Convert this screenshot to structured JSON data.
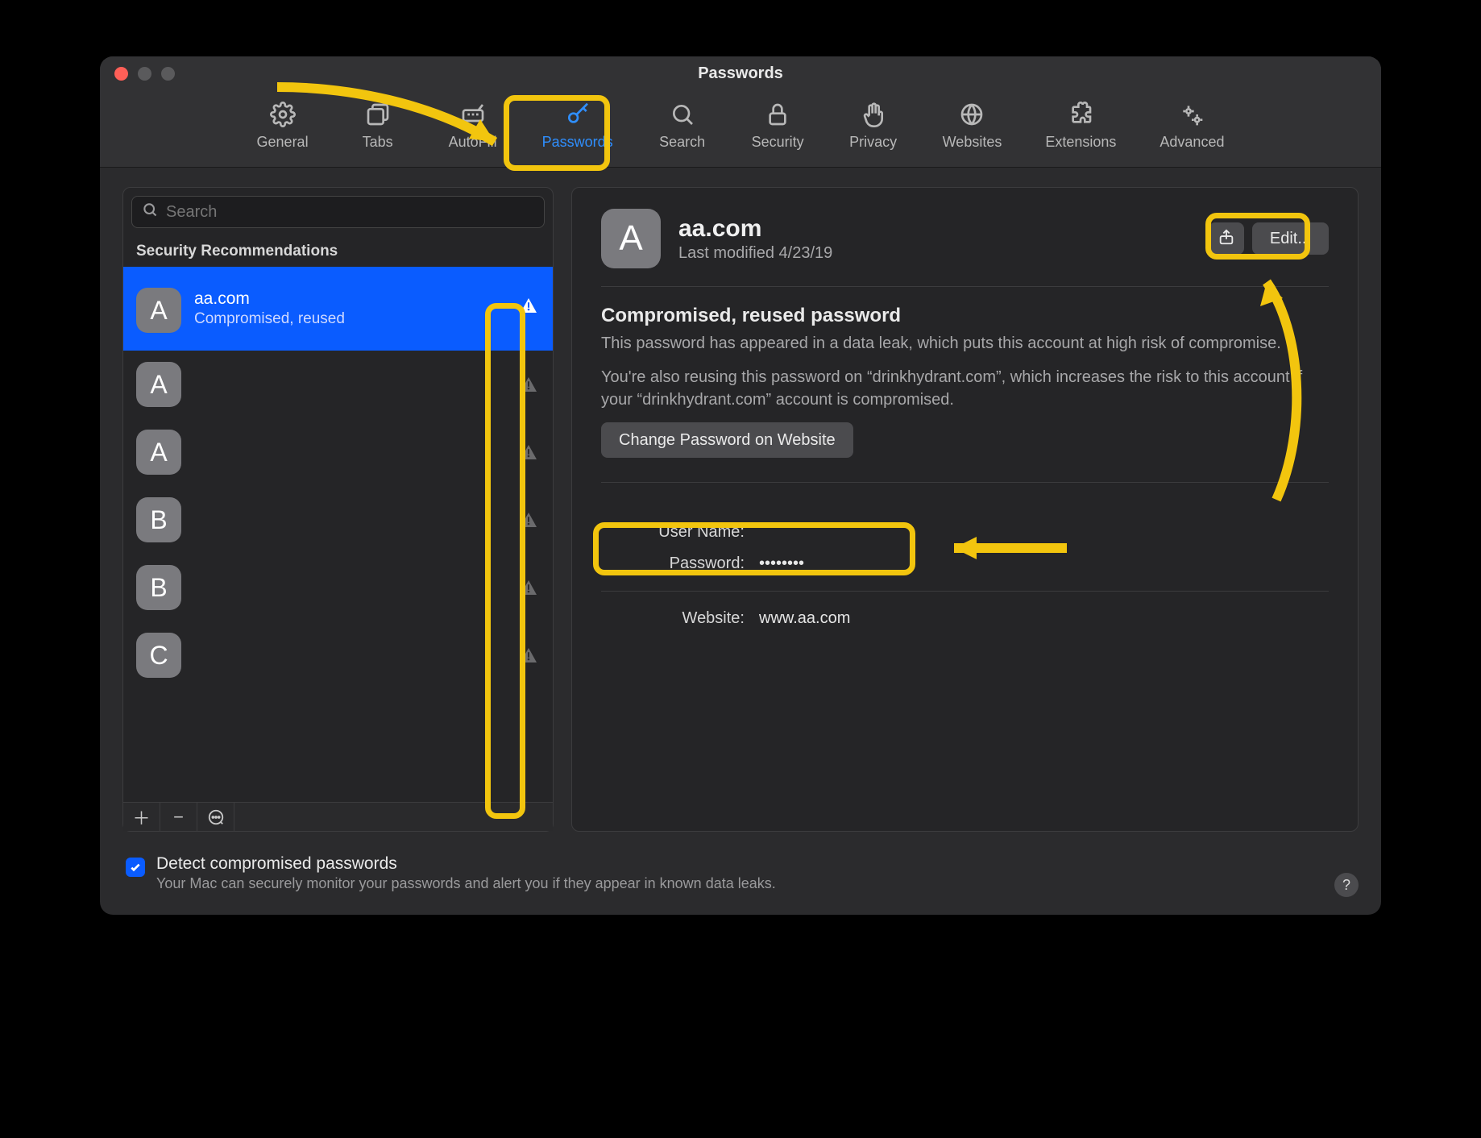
{
  "window": {
    "title": "Passwords"
  },
  "toolbar": {
    "items": [
      {
        "id": "general",
        "label": "General"
      },
      {
        "id": "tabs",
        "label": "Tabs"
      },
      {
        "id": "autofill",
        "label": "AutoFill"
      },
      {
        "id": "passwords",
        "label": "Passwords",
        "active": true
      },
      {
        "id": "search",
        "label": "Search"
      },
      {
        "id": "security",
        "label": "Security"
      },
      {
        "id": "privacy",
        "label": "Privacy"
      },
      {
        "id": "websites",
        "label": "Websites"
      },
      {
        "id": "extensions",
        "label": "Extensions"
      },
      {
        "id": "advanced",
        "label": "Advanced"
      }
    ]
  },
  "sidebar": {
    "search_placeholder": "Search",
    "section_header": "Security Recommendations",
    "items": [
      {
        "letter": "A",
        "title": "aa.com",
        "subtitle": "Compromised, reused",
        "selected": true,
        "warn": true
      },
      {
        "letter": "A",
        "title": "",
        "subtitle": "",
        "warn": true
      },
      {
        "letter": "A",
        "title": "",
        "subtitle": "",
        "warn": true
      },
      {
        "letter": "B",
        "title": "",
        "subtitle": "",
        "warn": true
      },
      {
        "letter": "B",
        "title": "",
        "subtitle": "",
        "warn": true
      },
      {
        "letter": "C",
        "title": "",
        "subtitle": "",
        "warn": true
      }
    ]
  },
  "detail": {
    "avatar_letter": "A",
    "title": "aa.com",
    "subtitle": "Last modified 4/23/19",
    "edit_label": "Edit...",
    "warning_heading": "Compromised, reused password",
    "warning_body1": "This password has appeared in a data leak, which puts this account at high risk of compromise.",
    "warning_body2": "You're also reusing this password on “drinkhydrant.com”, which increases the risk to this account if your “drinkhydrant.com” account is compromised.",
    "change_button": "Change Password on Website",
    "fields": {
      "username_label": "User Name:",
      "username_value": "",
      "password_label": "Password:",
      "password_value": "••••••••",
      "website_label": "Website:",
      "website_value": "www.aa.com"
    }
  },
  "footer": {
    "checkbox_checked": true,
    "title": "Detect compromised passwords",
    "subtitle": "Your Mac can securely monitor your passwords and alert you if they appear in known data leaks."
  }
}
